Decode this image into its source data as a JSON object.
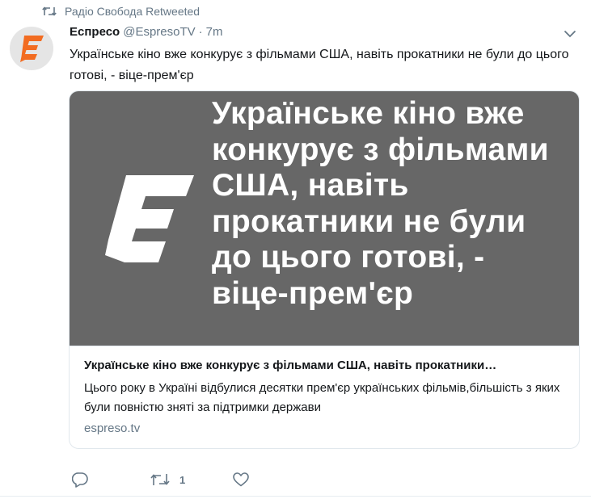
{
  "retweet_notice": {
    "text": "Радіо Свобода Retweeted"
  },
  "tweet": {
    "author_name": "Еспресо",
    "handle": "@EspresoTV",
    "separator": "·",
    "time": "7m",
    "text": "Українське кіно вже конкурує з фільмами США, навіть прокатники не були до цього готові, - віце-прем'єр"
  },
  "card": {
    "image_text": "Українське кіно вже конкурує з фільмами США, навіть прокатники не були до цього готові, - віце-прем'єр",
    "title": "Українське кіно вже конкурує з фільмами США, навіть прокатники…",
    "description": "Цього року в Україні відбулися десятки прем'єр українських фільмів,більшість з яких були повністю зняті за підтримки держави",
    "domain": "espreso.tv"
  },
  "actions": {
    "retweet_count": "1"
  },
  "colors": {
    "brand_orange": "#f26c21",
    "muted": "#657786",
    "card_image_bg": "#676767"
  }
}
